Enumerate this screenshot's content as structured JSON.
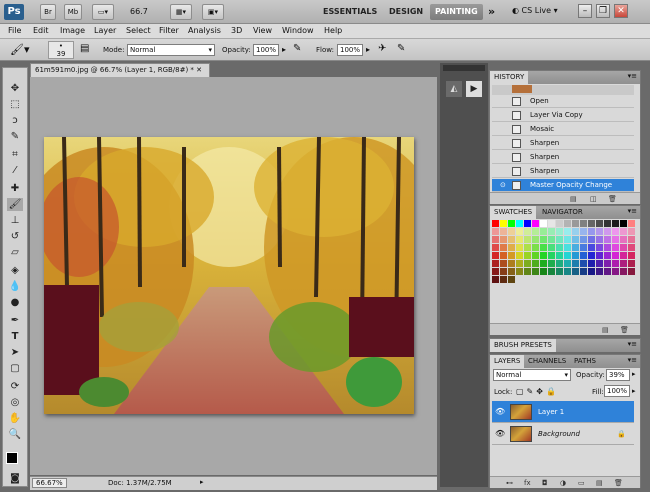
{
  "app": {
    "logo": "Ps",
    "br": "Br",
    "mb": "Mb",
    "zoom": "66.7",
    "workspaces": [
      "ESSENTIALS",
      "DESIGN",
      "PAINTING"
    ],
    "cslive": "CS Live"
  },
  "menu": [
    "File",
    "Edit",
    "Image",
    "Layer",
    "Select",
    "Filter",
    "Analysis",
    "3D",
    "View",
    "Window",
    "Help"
  ],
  "options": {
    "brush_size": "39",
    "mode_label": "Mode:",
    "mode_value": "Normal",
    "opacity_label": "Opacity:",
    "opacity_value": "100%",
    "flow_label": "Flow:",
    "flow_value": "100%"
  },
  "document": {
    "tab_title": "61m591m0.jpg @ 66.7% (Layer 1, RGB/8#) *",
    "zoom": "66.67%",
    "doc_info": "Doc: 1.37M/2.75M"
  },
  "history": {
    "title": "HISTORY",
    "items": [
      "Open",
      "Layer Via Copy",
      "Mosaic",
      "Sharpen",
      "Sharpen",
      "Sharpen",
      "Master Opacity Change"
    ]
  },
  "swatches": {
    "tabs": [
      "SWATCHES",
      "NAVIGATOR"
    ]
  },
  "brush_presets": {
    "title": "BRUSH PRESETS"
  },
  "layers": {
    "tabs": [
      "LAYERS",
      "CHANNELS",
      "PATHS"
    ],
    "blend": "Normal",
    "opacity_label": "Opacity:",
    "opacity_value": "39%",
    "lock_label": "Lock:",
    "fill_label": "Fill:",
    "fill_value": "100%",
    "items": [
      {
        "name": "Layer 1"
      },
      {
        "name": "Background"
      }
    ]
  }
}
